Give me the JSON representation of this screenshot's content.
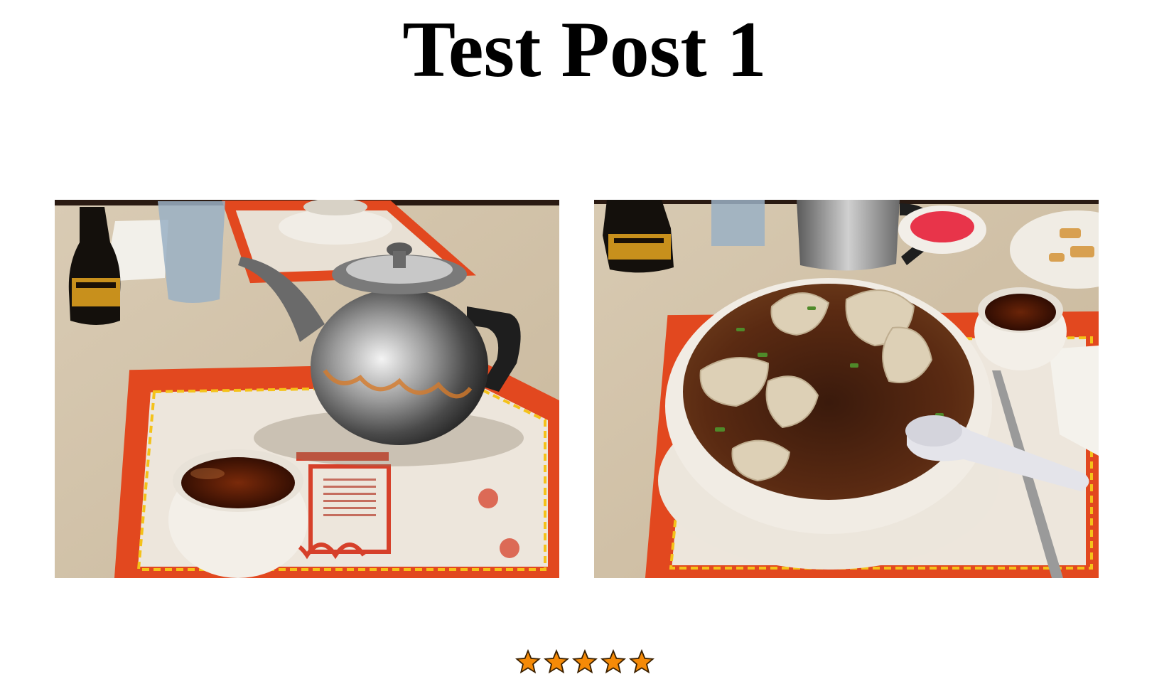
{
  "post": {
    "title": "Test Post 1"
  },
  "photos": [
    {
      "subject": "teapot-and-tea-cup-on-chinese-zodiac-placemat"
    },
    {
      "subject": "wonton-soup-bowl-with-spoon-on-chinese-zodiac-placemat"
    }
  ],
  "rating": {
    "value": 5,
    "max": 5,
    "color": "#f58a07",
    "outline": "#3a2000"
  }
}
